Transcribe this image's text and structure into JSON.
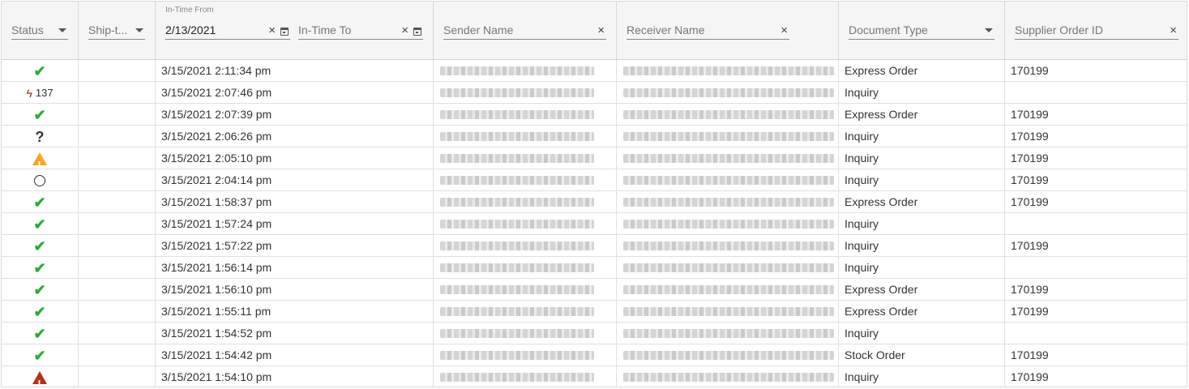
{
  "columns": {
    "status": {
      "label": "Status"
    },
    "shipto": {
      "label": "Ship-t..."
    },
    "intime_from": {
      "label": "In-Time From",
      "value": "2/13/2021"
    },
    "intime_to": {
      "placeholder": "In-Time To"
    },
    "sender": {
      "placeholder": "Sender Name"
    },
    "receiver": {
      "placeholder": "Receiver Name"
    },
    "doctype": {
      "label": "Document Type"
    },
    "supplier": {
      "placeholder": "Supplier Order ID"
    }
  },
  "icons": {
    "check": "check-icon",
    "bolt": "bolt-icon",
    "question": "question-icon",
    "warning": "warning-icon",
    "circle": "circle-icon",
    "error": "error-icon"
  },
  "colors": {
    "check": "#2eaa3a",
    "warning": "#f5a623",
    "error": "#b2331b",
    "bolt": "#8b2a10"
  },
  "rows": [
    {
      "status": "check",
      "time": "3/15/2021 2:11:34 pm",
      "doctype": "Express Order",
      "supplier": "170199"
    },
    {
      "status": "bolt",
      "count": "137",
      "time": "3/15/2021 2:07:46 pm",
      "doctype": "Inquiry",
      "supplier": ""
    },
    {
      "status": "check",
      "time": "3/15/2021 2:07:39 pm",
      "doctype": "Express Order",
      "supplier": "170199"
    },
    {
      "status": "question",
      "time": "3/15/2021 2:06:26 pm",
      "doctype": "Inquiry",
      "supplier": "170199"
    },
    {
      "status": "warning",
      "time": "3/15/2021 2:05:10 pm",
      "doctype": "Inquiry",
      "supplier": "170199"
    },
    {
      "status": "circle",
      "time": "3/15/2021 2:04:14 pm",
      "doctype": "Inquiry",
      "supplier": "170199"
    },
    {
      "status": "check",
      "time": "3/15/2021 1:58:37 pm",
      "doctype": "Express Order",
      "supplier": "170199"
    },
    {
      "status": "check",
      "time": "3/15/2021 1:57:24 pm",
      "doctype": "Inquiry",
      "supplier": ""
    },
    {
      "status": "check",
      "time": "3/15/2021 1:57:22 pm",
      "doctype": "Inquiry",
      "supplier": "170199"
    },
    {
      "status": "check",
      "time": "3/15/2021 1:56:14 pm",
      "doctype": "Inquiry",
      "supplier": ""
    },
    {
      "status": "check",
      "time": "3/15/2021 1:56:10 pm",
      "doctype": "Express Order",
      "supplier": "170199"
    },
    {
      "status": "check",
      "time": "3/15/2021 1:55:11 pm",
      "doctype": "Express Order",
      "supplier": "170199"
    },
    {
      "status": "check",
      "time": "3/15/2021 1:54:52 pm",
      "doctype": "Inquiry",
      "supplier": ""
    },
    {
      "status": "check",
      "time": "3/15/2021 1:54:42 pm",
      "doctype": "Stock Order",
      "supplier": "170199"
    },
    {
      "status": "error",
      "time": "3/15/2021 1:54:10 pm",
      "doctype": "Inquiry",
      "supplier": "170199"
    }
  ]
}
